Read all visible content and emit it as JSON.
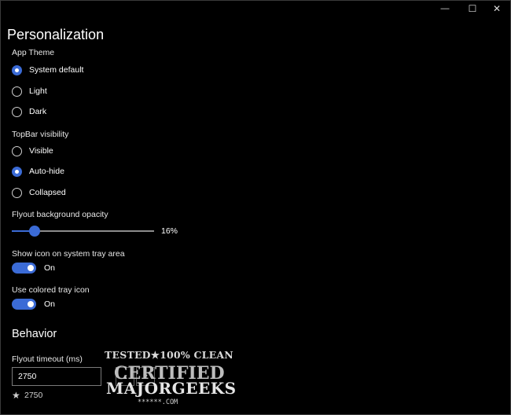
{
  "window": {
    "minimize_glyph": "—",
    "maximize_glyph": "☐",
    "close_glyph": "✕"
  },
  "page": {
    "title": "Personalization"
  },
  "app_theme": {
    "label": "App Theme",
    "options": [
      {
        "label": "System default",
        "selected": true
      },
      {
        "label": "Light",
        "selected": false
      },
      {
        "label": "Dark",
        "selected": false
      }
    ]
  },
  "topbar": {
    "label": "TopBar visibility",
    "options": [
      {
        "label": "Visible",
        "selected": false
      },
      {
        "label": "Auto-hide",
        "selected": true
      },
      {
        "label": "Collapsed",
        "selected": false
      }
    ]
  },
  "opacity": {
    "label": "Flyout background opacity",
    "value_text": "16%",
    "value": 0.16
  },
  "tray_icon": {
    "label": "Show icon on system tray area",
    "state": "On",
    "on": true
  },
  "colored_icon": {
    "label": "Use colored tray icon",
    "state": "On",
    "on": true
  },
  "behavior": {
    "section_title": "Behavior",
    "timeout_label": "Flyout timeout (ms)",
    "timeout_value": "2750",
    "default_value": "2750",
    "up_glyph": "▲",
    "down_glyph": "▼",
    "star_glyph": "★"
  },
  "watermark": {
    "line1": "TESTED★100% CLEAN",
    "line2": "CERTIFIED",
    "line3": "MAJORGEEKS",
    "line4": "******.COM"
  },
  "colors": {
    "accent": "#3b6bd6",
    "background": "#000000",
    "text": "#ffffff"
  }
}
